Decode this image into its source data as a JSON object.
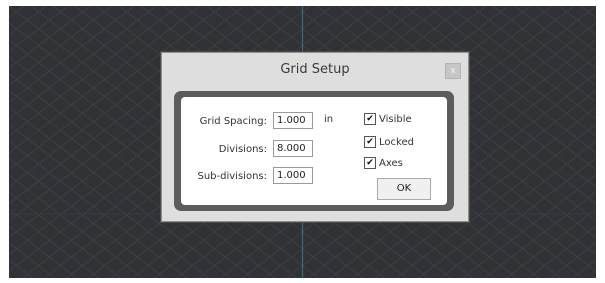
{
  "dialog": {
    "title": "Grid Setup",
    "close_label": "x"
  },
  "fields": {
    "grid_spacing": {
      "label": "Grid Spacing:",
      "value": "1.000",
      "unit": "in"
    },
    "divisions": {
      "label": "Divisions:",
      "value": "8.000"
    },
    "sub_divisions": {
      "label": "Sub-divisions:",
      "value": "1.000"
    }
  },
  "checkboxes": {
    "visible": {
      "label": "Visible",
      "checked": true
    },
    "locked": {
      "label": "Locked",
      "checked": true
    },
    "axes": {
      "label": "Axes",
      "checked": true
    }
  },
  "ok_label": "OK",
  "colors": {
    "viewport_bg": "#303235",
    "grid_line": "#3c3f43",
    "axis_line": "#3e6a80"
  }
}
